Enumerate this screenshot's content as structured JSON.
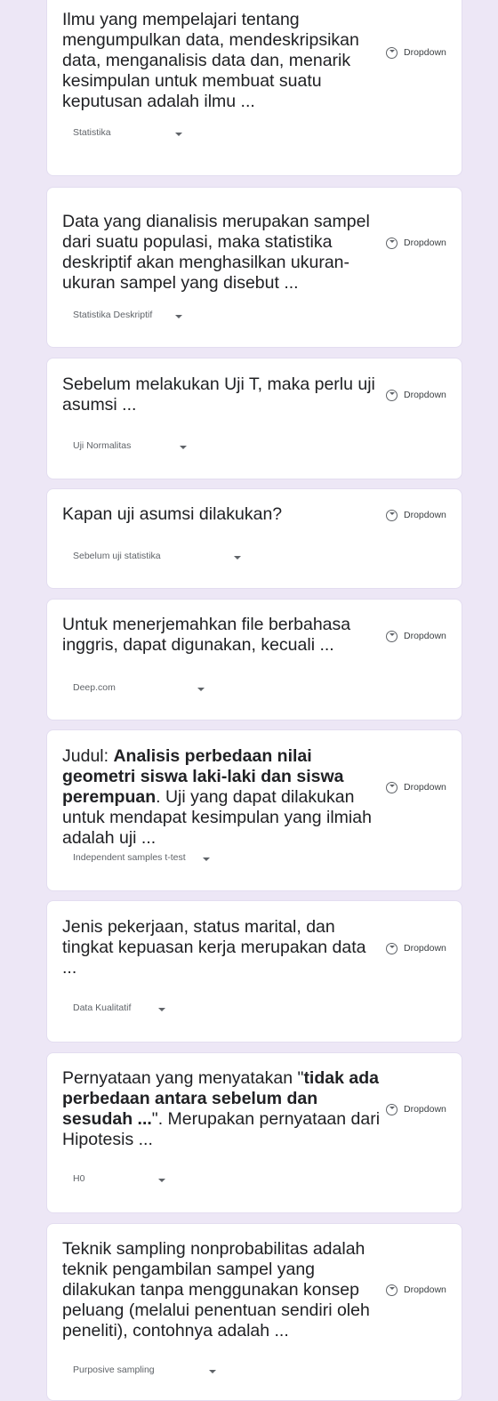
{
  "questions": [
    {
      "parts": [
        {
          "t": "Ilmu yang mempelajari tentang mengumpulkan data, mendeskripsikan data, menganalisis data dan, menarik kesimpulan untuk membuat suatu keputusan adalah ilmu ..."
        }
      ],
      "type": "Dropdown",
      "answer": "Statistika"
    },
    {
      "parts": [
        {
          "t": "Data yang dianalisis merupakan sampel dari suatu populasi, maka statistika deskriptif akan menghasilkan ukuran-ukuran sampel yang disebut ..."
        }
      ],
      "type": "Dropdown",
      "answer": "Statistika Deskriptif"
    },
    {
      "parts": [
        {
          "t": "Sebelum melakukan Uji T, maka perlu uji asumsi ..."
        }
      ],
      "type": "Dropdown",
      "answer": "Uji Normalitas"
    },
    {
      "parts": [
        {
          "t": "Kapan uji asumsi dilakukan?"
        }
      ],
      "type": "Dropdown",
      "answer": "Sebelum uji statistika"
    },
    {
      "parts": [
        {
          "t": "Untuk menerjemahkan file berbahasa inggris, dapat digunakan, kecuali ..."
        }
      ],
      "type": "Dropdown",
      "answer": "Deep.com"
    },
    {
      "parts": [
        {
          "t": "Judul: "
        },
        {
          "t": "Analisis perbedaan nilai geometri siswa laki-laki dan siswa perempuan",
          "b": true
        },
        {
          "t": ". Uji yang dapat dilakukan untuk mendapat kesimpulan yang ilmiah adalah uji ..."
        }
      ],
      "type": "Dropdown",
      "answer": "Independent samples t-test"
    },
    {
      "parts": [
        {
          "t": "Jenis pekerjaan, status marital, dan tingkat kepuasan kerja merupakan data ..."
        }
      ],
      "type": "Dropdown",
      "answer": "Data Kualitatif"
    },
    {
      "parts": [
        {
          "t": "Pernyataan yang menyatakan \""
        },
        {
          "t": "tidak ada perbedaan antara sebelum dan sesudah ...",
          "b": true
        },
        {
          "t": "\". Merupakan pernyataan dari Hipotesis ..."
        }
      ],
      "type": "Dropdown",
      "answer": "H0"
    },
    {
      "parts": [
        {
          "t": "Teknik sampling nonprobabilitas adalah teknik pengambilan sampel yang dilakukan tanpa menggunakan konsep peluang (melalui penentuan sendiri oleh peneliti), contohnya adalah ..."
        }
      ],
      "type": "Dropdown",
      "answer": "Purposive sampling"
    }
  ],
  "icons": {
    "question_type": "dropdown-circle-icon",
    "answer_caret": "caret-down-icon"
  },
  "colors": {
    "background": "#ede7f6",
    "card": "#ffffff",
    "text": "#202124",
    "muted": "#5f6368"
  }
}
